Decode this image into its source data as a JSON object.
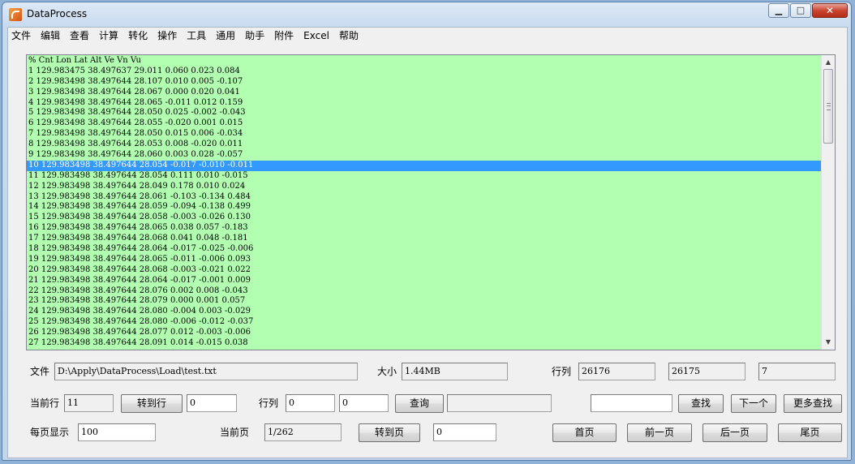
{
  "window": {
    "title": "DataProcess"
  },
  "menu": [
    "文件",
    "编辑",
    "查看",
    "计算",
    "转化",
    "操作",
    "工具",
    "通用",
    "助手",
    "附件",
    "Excel",
    "帮助"
  ],
  "data_lines": [
    "% Cnt Lon Lat Alt Ve Vn Vu",
    "1 129.983475 38.497637 29.011 0.060 0.023 0.084",
    "2 129.983498 38.497644 28.107 0.010 0.005 -0.107",
    "3 129.983498 38.497644 28.067 0.000 0.020 0.041",
    "4 129.983498 38.497644 28.065 -0.011 0.012 0.159",
    "5 129.983498 38.497644 28.050 0.025 -0.002 -0.043",
    "6 129.983498 38.497644 28.055 -0.020 0.001 0.015",
    "7 129.983498 38.497644 28.050 0.015 0.006 -0.034",
    "8 129.983498 38.497644 28.053 0.008 -0.020 0.011",
    "9 129.983498 38.497644 28.060 0.003 0.028 -0.057",
    "10 129.983498 38.497644 28.054 -0.017 -0.010 -0.011",
    "11 129.983498 38.497644 28.054 0.111 0.010 -0.015",
    "12 129.983498 38.497644 28.049 0.178 0.010 0.024",
    "13 129.983498 38.497644 28.061 -0.103 -0.134 0.484",
    "14 129.983498 38.497644 28.059 -0.094 -0.138 0.499",
    "15 129.983498 38.497644 28.058 -0.003 -0.026 0.130",
    "16 129.983498 38.497644 28.065 0.038 0.057 -0.183",
    "17 129.983498 38.497644 28.068 0.041 0.048 -0.181",
    "18 129.983498 38.497644 28.064 -0.017 -0.025 -0.006",
    "19 129.983498 38.497644 28.065 -0.011 -0.006 0.093",
    "20 129.983498 38.497644 28.068 -0.003 -0.021 0.022",
    "21 129.983498 38.497644 28.064 -0.017 -0.001 0.009",
    "22 129.983498 38.497644 28.076 0.002 0.008 -0.043",
    "23 129.983498 38.497644 28.079 0.000 0.001 0.057",
    "24 129.983498 38.497644 28.080 -0.004 0.003 -0.029",
    "25 129.983498 38.497644 28.080 -0.006 -0.012 -0.037",
    "26 129.983498 38.497644 28.077 0.012 -0.003 -0.006",
    "27 129.983498 38.497644 28.091 0.014 -0.015 0.038"
  ],
  "selected_line": 10,
  "row1": {
    "file_label": "文件",
    "file_path": "D:\\Apply\\DataProcess\\Load\\test.txt",
    "size_label": "大小",
    "size_value": "1.44MB",
    "rowcol_label": "行列",
    "rowcol_value1": "26176",
    "rowcol_value2": "26175",
    "rowcol_value3": "7"
  },
  "row2": {
    "current_row_label": "当前行",
    "current_row_value": "11",
    "goto_row_button": "转到行",
    "goto_row_input": "0",
    "rowcol_label": "行列",
    "row_input": "0",
    "col_input": "0",
    "query_button": "查询",
    "query_result": "",
    "search_input": "",
    "find_button": "查找",
    "next_button": "下一个",
    "more_find_button": "更多查找"
  },
  "row3": {
    "per_page_label": "每页显示",
    "per_page_value": "100",
    "current_page_label": "当前页",
    "current_page_value": "1/262",
    "goto_page_button": "转到页",
    "goto_page_input": "0",
    "first_page_button": "首页",
    "prev_page_button": "前一页",
    "next_page_button": "后一页",
    "last_page_button": "尾页"
  },
  "colors": {
    "data_bg": "#b2ffb2",
    "selection": "#3399ff"
  }
}
